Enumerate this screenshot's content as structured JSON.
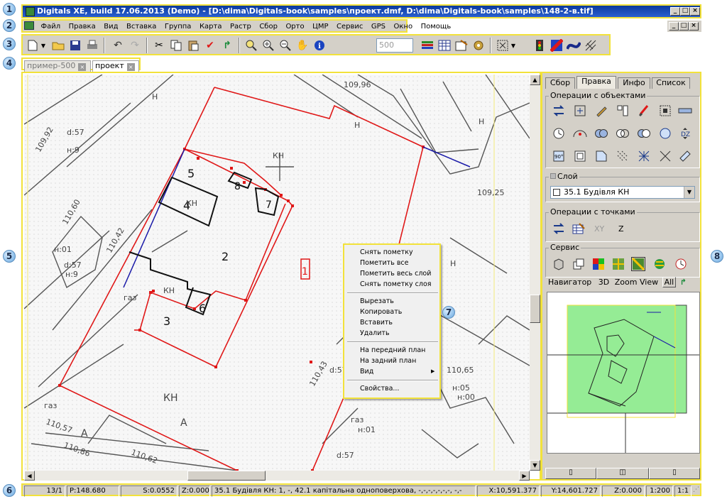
{
  "window": {
    "title": "Digitals XE, build 17.06.2013 (Demo) - [D:\\dima\\Digitals-book\\samples\\проект.dmf, D:\\dima\\Digitals-book\\samples\\148-2-в.tif]",
    "min": "_",
    "max": "□",
    "close": "×"
  },
  "menu": {
    "items": [
      "Файл",
      "Правка",
      "Вид",
      "Вставка",
      "Группа",
      "Карта",
      "Растр",
      "Сбор",
      "Орто",
      "ЦМР",
      "Сервис",
      "GPS",
      "Окно",
      "Помощь"
    ]
  },
  "toolbar": {
    "zoom_value": "500"
  },
  "doc_tabs": [
    {
      "label": "пример-500",
      "active": false
    },
    {
      "label": "проект",
      "active": true
    }
  ],
  "map": {
    "labels": [
      "5",
      "4",
      "8",
      "7",
      "2",
      "3",
      "6",
      "1",
      "КН",
      "КН",
      "КН",
      "КН",
      "Н",
      "Н",
      "Н",
      "Н",
      "А",
      "А",
      "газ",
      "газ",
      "газ",
      "н:9",
      "н:9",
      "d:57",
      "d:57",
      "d:57",
      "d:57",
      "109,92",
      "110,60",
      "109,96",
      "109,25",
      "110,65",
      "110,57",
      "110,86",
      "110,62",
      "110,43",
      "110,42",
      "н:01",
      "н:05",
      "н:00",
      "н:01"
    ]
  },
  "context_menu": {
    "items": [
      "Снять пометку",
      "Пометить все",
      "Пометить весь слой",
      "Снять пометку слоя",
      "Вырезать",
      "Копировать",
      "Вставить",
      "Удалить",
      "На передний план",
      "На задний план",
      "Вид",
      "Свойства..."
    ],
    "submenu_arrow": "▶"
  },
  "panel": {
    "tabs": [
      "Сбор",
      "Правка",
      "Инфо",
      "Список"
    ],
    "group_objects": "Операции с объектами",
    "group_layer": "Слой",
    "layer_value": "35.1 Будівля КН",
    "group_points": "Операции с точками",
    "point_labels": [
      "XY",
      "Z"
    ],
    "group_service": "Сервис",
    "navigator": {
      "label": "Навигатор",
      "opt1": "3D",
      "opt2": "Zoom View",
      "opt3": "All"
    }
  },
  "status": {
    "cells": [
      "13/1",
      "P:148.680",
      "S:0.0552",
      "Z:0.000",
      "35.1 Будівля КН: 1, -, 42.1 капітальна одноповерхова, -,-,-,-,-,-,-, -,-",
      "X:10,591.377",
      "Y:14,601.727",
      "Z:0.000",
      "1:200",
      "1:1"
    ]
  },
  "annotations": [
    "1",
    "2",
    "3",
    "4",
    "5",
    "6",
    "7",
    "8"
  ],
  "colors": {
    "accent_red": "#e01818",
    "highlight": "#f2e23a",
    "title_blue": "#0b3a9e",
    "nav_green": "#95ec95"
  }
}
